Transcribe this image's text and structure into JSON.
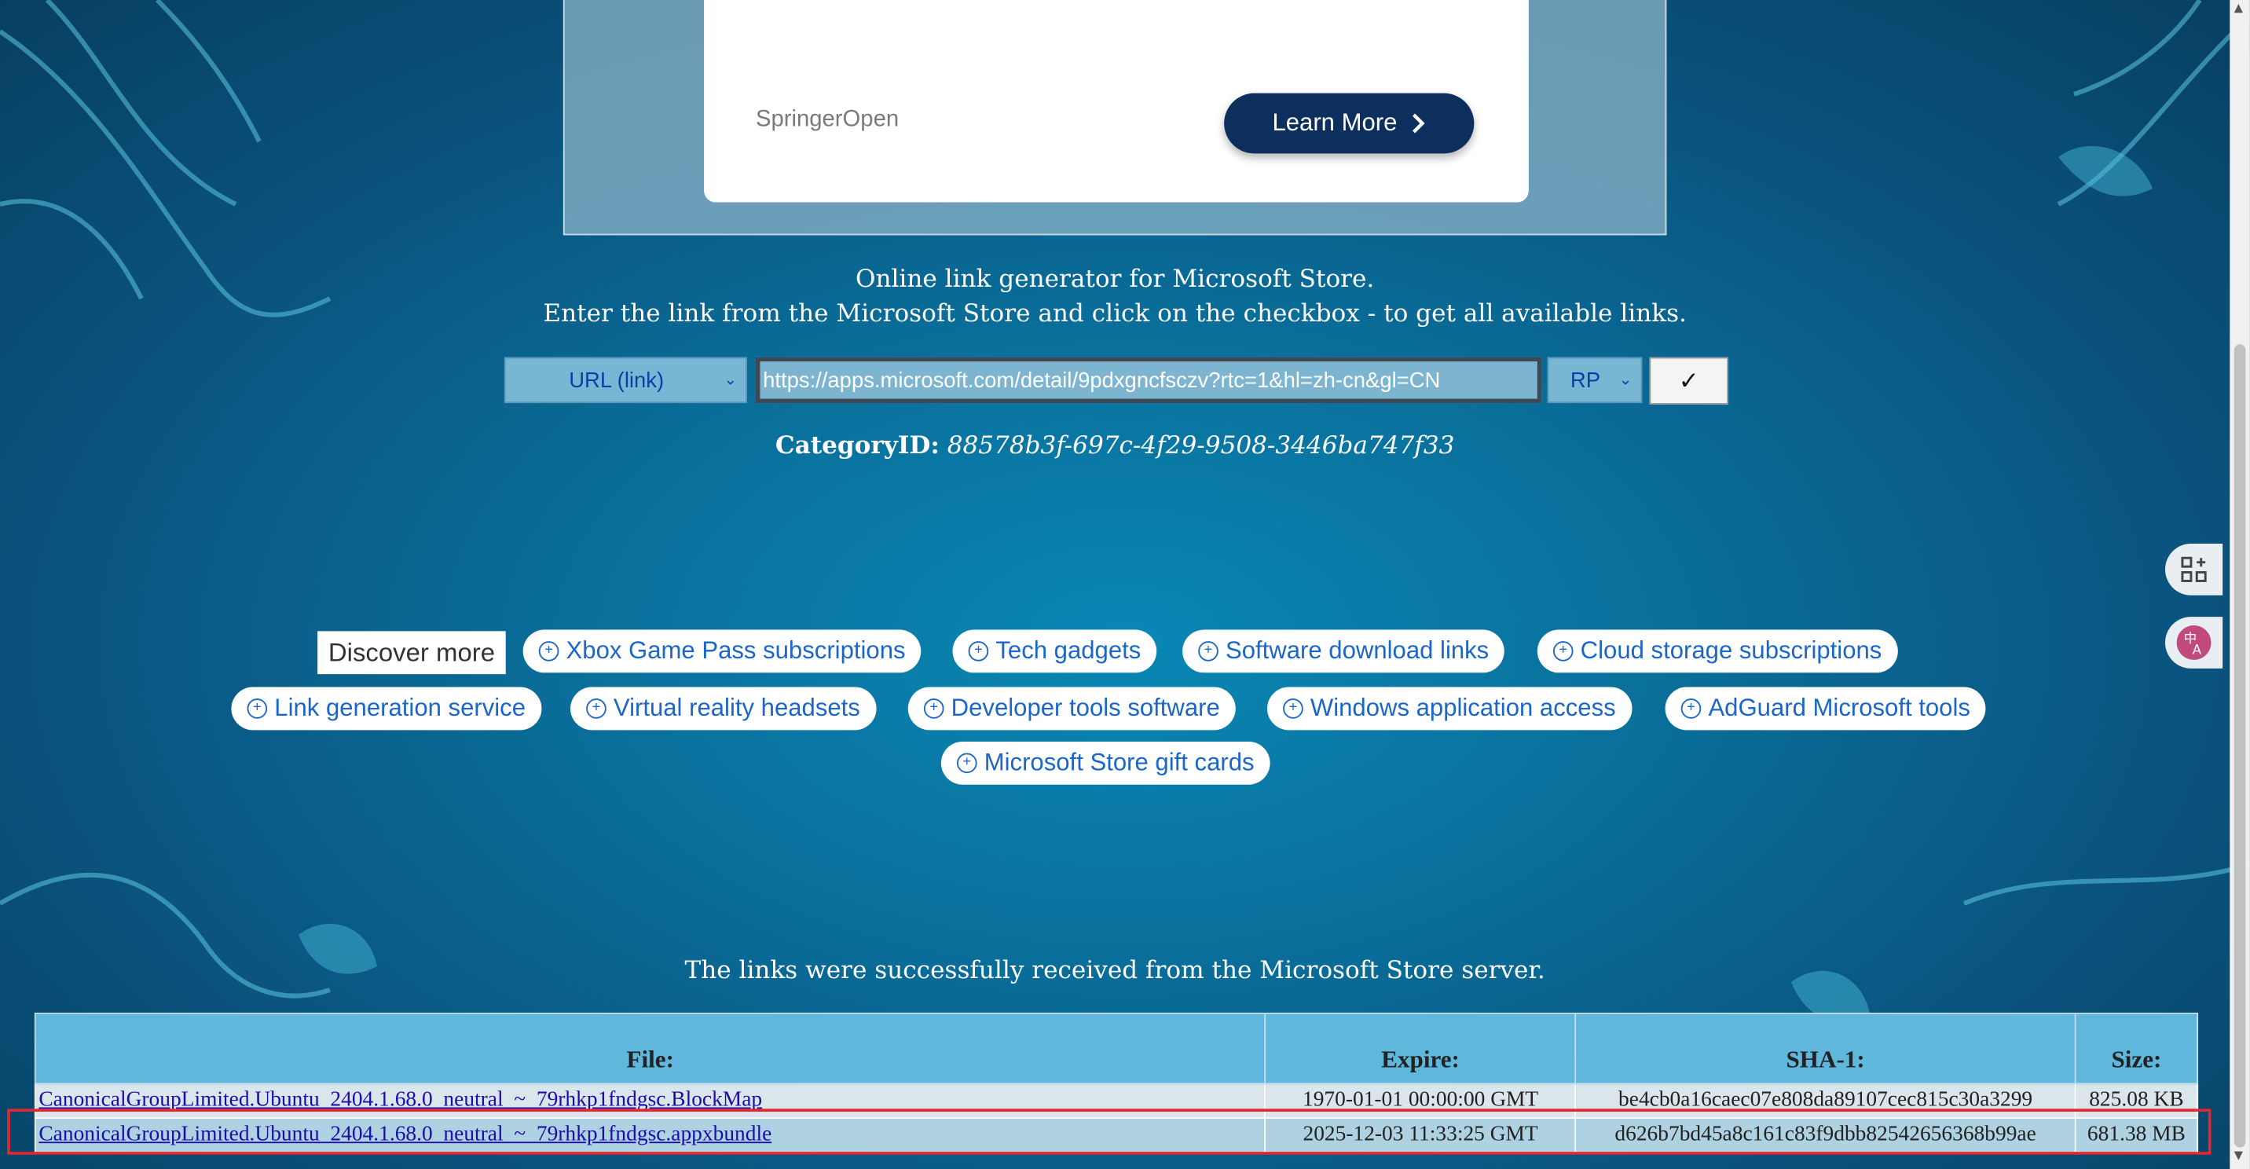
{
  "ad": {
    "brand": "SpringerOpen",
    "button_label": "Learn More"
  },
  "intro": {
    "line1": "Online link generator for Microsoft Store.",
    "line2": "Enter the link from the Microsoft Store and click on the checkbox - to get all available links."
  },
  "form": {
    "type_select": "URL (link)",
    "url_value": "https://apps.microsoft.com/detail/9pdxgncfsczv?rtc=1&hl=zh-cn&gl=CN",
    "ring_select": "RP",
    "submit_label": "✓"
  },
  "category": {
    "label": "CategoryID:",
    "value": "88578b3f-697c-4f29-9508-3446ba747f33"
  },
  "discover": {
    "label": "Discover more",
    "chips": [
      "Xbox Game Pass subscriptions",
      "Tech gadgets",
      "Software download links",
      "Cloud storage subscriptions",
      "Link generation service",
      "Virtual reality headsets",
      "Developer tools software",
      "Windows application access",
      "AdGuard Microsoft tools",
      "Microsoft Store gift cards"
    ]
  },
  "status": "The links were successfully received from the Microsoft Store server.",
  "table": {
    "headers": [
      "File:",
      "Expire:",
      "SHA-1:",
      "Size:"
    ],
    "rows": [
      [
        "CanonicalGroupLimited.Ubuntu_2404.1.68.0_neutral_~_79rhkp1fndgsc.BlockMap",
        "1970-01-01 00:00:00 GMT",
        "be4cb0a16caec07e808da89107cec815c30a3299",
        "825.08 KB"
      ],
      [
        "CanonicalGroupLimited.Ubuntu_2404.1.68.0_neutral_~_79rhkp1fndgsc.appxbundle",
        "2025-12-03 11:33:25 GMT",
        "d626b7bd45a8c161c83f9dbb82542656368b99ae",
        "681.38 MB"
      ]
    ]
  },
  "icons": {
    "chevron": "chevron-right-icon",
    "side1": "qr-app-icon",
    "side2": "translate-icon"
  }
}
